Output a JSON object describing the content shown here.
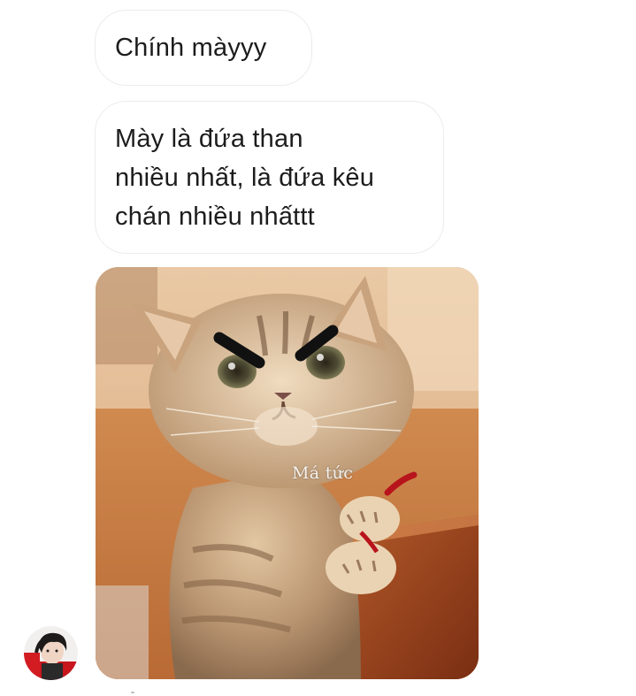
{
  "conversation": {
    "messages": [
      {
        "type": "text",
        "lines": [
          "Chính màyyy"
        ]
      },
      {
        "type": "text",
        "lines": [
          "Mày là đứa than",
          "nhiều nhất, là đứa kêu",
          "chán nhiều nhấttt"
        ]
      },
      {
        "type": "image",
        "subject": "angry-cat-meme",
        "caption": "Má tức"
      }
    ]
  },
  "sender": {
    "avatar": "profile-photo"
  }
}
